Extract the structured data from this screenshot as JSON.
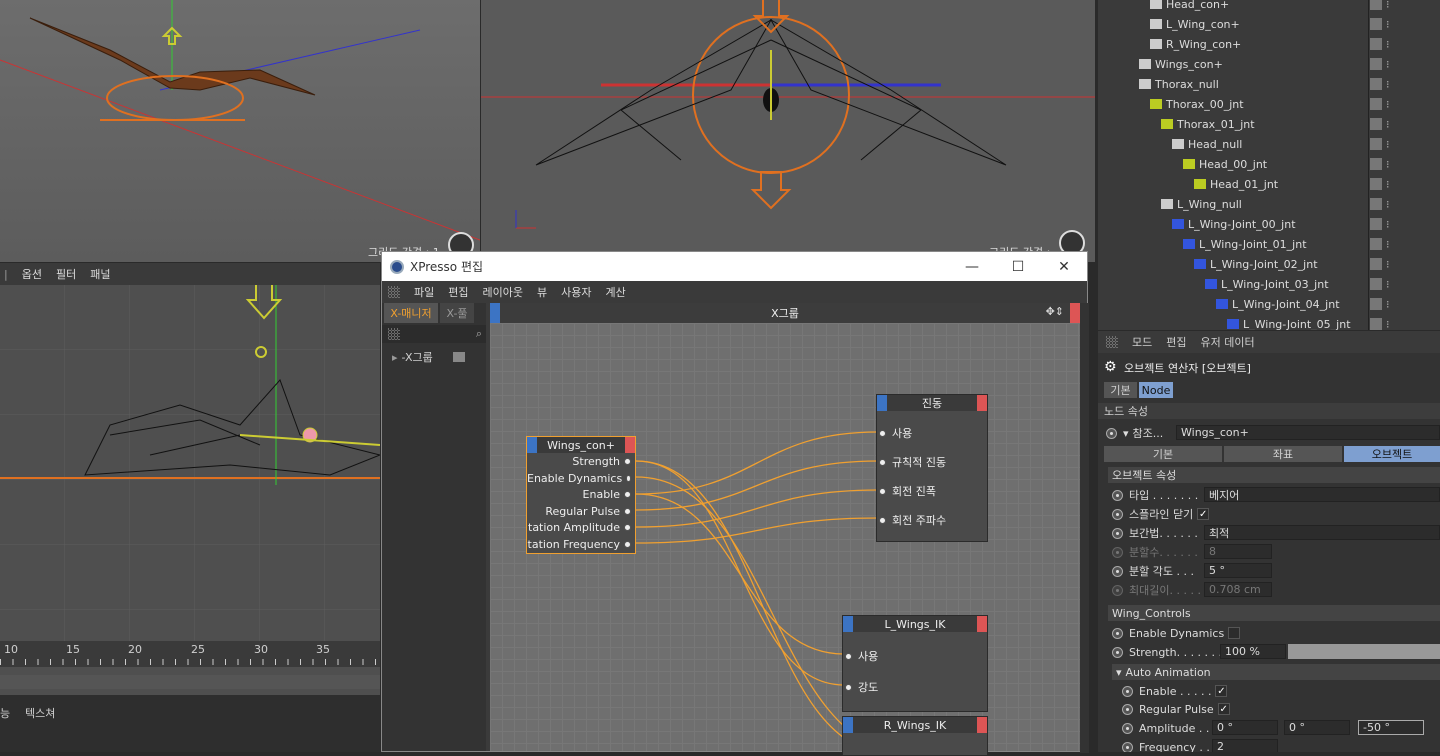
{
  "viewport_top_left": {
    "grid_label": "그리드 간격 : 1"
  },
  "viewport_top_right": {
    "grid_label": "그리드 간격 :"
  },
  "viewport_side": {
    "menu": [
      "옵션",
      "필터",
      "패널"
    ],
    "ruler_ticks": [
      "10",
      "15",
      "20",
      "25",
      "30",
      "35"
    ],
    "bottom_tabs": [
      "능",
      "텍스쳐"
    ]
  },
  "xpresso": {
    "title": "XPresso 편집",
    "menu": [
      "파일",
      "편집",
      "레이아웃",
      "뷰",
      "사용자",
      "계산"
    ],
    "tab_manager": "X-매니저",
    "tab_pool": "X-풀",
    "tree_item": "-X그룹",
    "canvas_title": "X그룹",
    "nodes": {
      "wings": {
        "title": "Wings_con+",
        "ports": [
          "Strength",
          "Enable Dynamics",
          "Enable",
          "Regular Pulse",
          "tation Amplitude",
          "tation Frequency"
        ]
      },
      "vibrate": {
        "title": "진동",
        "ports": [
          "사용",
          "규칙적 진동",
          "회전 진폭",
          "회전 주파수"
        ]
      },
      "lik": {
        "title": "L_Wings_IK",
        "ports": [
          "사용",
          "강도"
        ]
      },
      "rik": {
        "title": "R_Wings_IK"
      }
    },
    "wire_color": "#f0a030"
  },
  "object_manager": {
    "items": [
      {
        "label": "Head_con+",
        "indent": 4
      },
      {
        "label": "L_Wing_con+",
        "indent": 4
      },
      {
        "label": "R_Wing_con+",
        "indent": 4
      },
      {
        "label": "Wings_con+",
        "indent": 3
      },
      {
        "label": "Thorax_null",
        "indent": 3
      },
      {
        "label": "Thorax_00_jnt",
        "indent": 4
      },
      {
        "label": "Thorax_01_jnt",
        "indent": 5
      },
      {
        "label": "Head_null",
        "indent": 6
      },
      {
        "label": "Head_00_jnt",
        "indent": 7
      },
      {
        "label": "Head_01_jnt",
        "indent": 8
      },
      {
        "label": "L_Wing_null",
        "indent": 5
      },
      {
        "label": "L_Wing-Joint_00_jnt",
        "indent": 6
      },
      {
        "label": "L_Wing-Joint_01_jnt",
        "indent": 7
      },
      {
        "label": "L_Wing-Joint_02_jnt",
        "indent": 8
      },
      {
        "label": "L_Wing-Joint_03_jnt",
        "indent": 9
      },
      {
        "label": "L_Wing-Joint_04_jnt",
        "indent": 10
      },
      {
        "label": "L_Wing-Joint_05_jnt",
        "indent": 11
      }
    ]
  },
  "attributes": {
    "menu": [
      "모드",
      "편집",
      "유저 데이터"
    ],
    "header": "오브젝트 연산자 [오브젝트]",
    "tab_basic": "기본",
    "tab_node": "Node",
    "node_props": "노드 속성",
    "ref_label": "참조...",
    "ref_value": "Wings_con+",
    "subtabs": [
      "기본",
      "좌표",
      "오브젝트"
    ],
    "obj_props": "오브젝트 속성",
    "type_label": "타입 . . . . . . .",
    "type_value": "베지어",
    "close_label": "스플라인 닫기",
    "interp_label": "보간법. . . . . .",
    "interp_value": "최적",
    "sub_label": "분할수. . . . . .",
    "sub_value": "8",
    "angle_label": "분할 각도 . . .",
    "angle_value": "5 °",
    "maxlen_label": "최대길이. . . . .",
    "maxlen_value": "0.708 cm",
    "wing_controls": "Wing_Controls",
    "enable_dyn": "Enable Dynamics",
    "strength_label": "Strength. . . . . . .",
    "strength_value": "100 %",
    "auto_anim": "Auto Animation",
    "enable_label": "Enable . . . . .",
    "regular_label": "Regular Pulse",
    "amp_label": "Amplitude . .",
    "amp_values": [
      "0 °",
      "0 °",
      "-50 °"
    ],
    "freq_label": "Frequency . .",
    "freq_value": "2"
  }
}
